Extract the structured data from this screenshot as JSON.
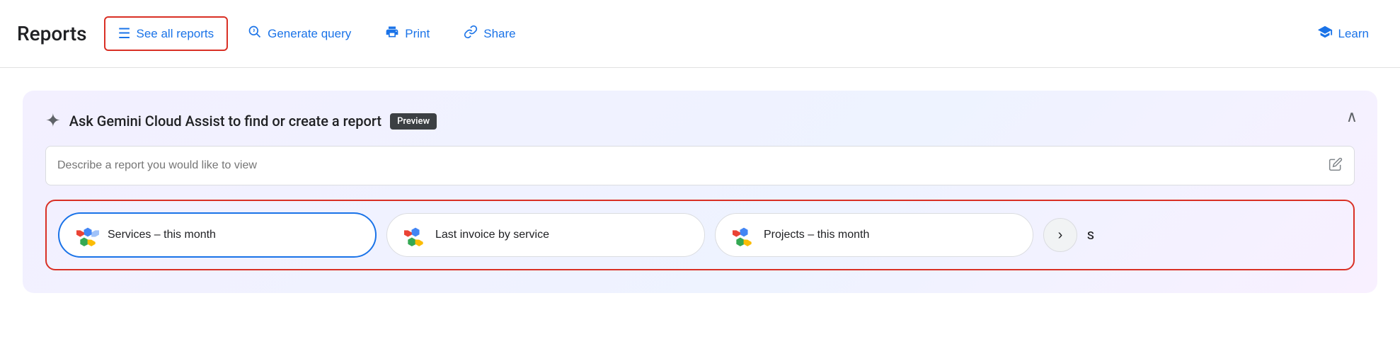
{
  "toolbar": {
    "title": "Reports",
    "buttons": [
      {
        "id": "see-all-reports",
        "label": "See all reports",
        "icon": "☰",
        "active": true
      },
      {
        "id": "generate-query",
        "label": "Generate query",
        "icon": "🔍"
      },
      {
        "id": "print",
        "label": "Print",
        "icon": "🖨"
      },
      {
        "id": "share",
        "label": "Share",
        "icon": "🔗"
      }
    ],
    "learn_label": "Learn",
    "learn_icon": "🎓"
  },
  "gemini_panel": {
    "sparkle_icon": "✦",
    "title": "Ask Gemini Cloud Assist to find or create a report",
    "preview_badge": "Preview",
    "collapse_icon": "∧",
    "input_placeholder": "Describe a report you would like to view",
    "edit_icon": "✏",
    "suggestions": [
      {
        "id": "services-this-month",
        "label": "Services – this month",
        "highlighted": true
      },
      {
        "id": "last-invoice-by-service",
        "label": "Last invoice by service",
        "highlighted": false
      },
      {
        "id": "projects-this-month",
        "label": "Projects – this month",
        "highlighted": false
      }
    ],
    "next_icon": "›",
    "partial_label": "S"
  }
}
